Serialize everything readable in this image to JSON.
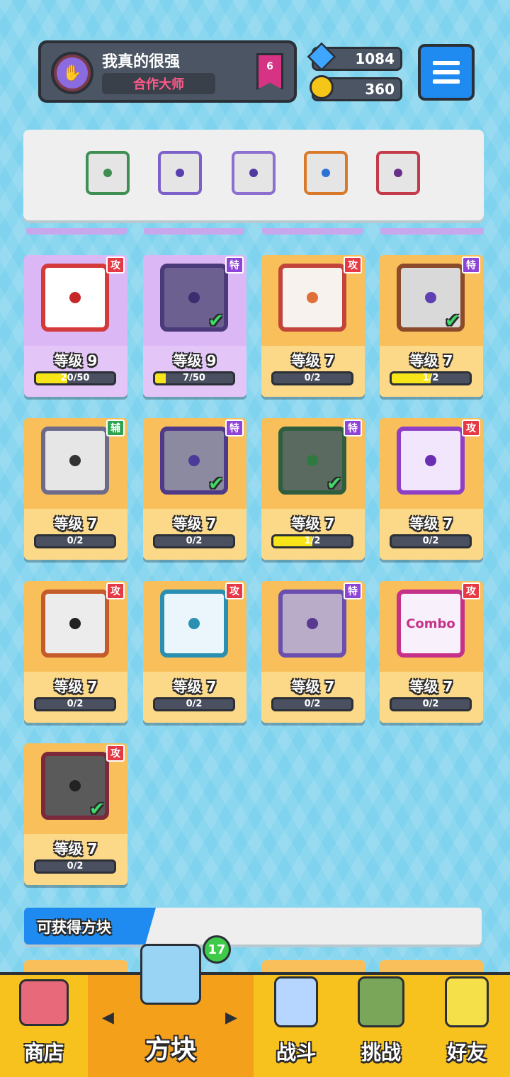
{
  "profile": {
    "name": "我真的很强",
    "title": "合作大师",
    "rank": "6"
  },
  "currency": {
    "gems": "1084",
    "coins": "360"
  },
  "deck": [
    {
      "name": "deck-slot-1",
      "color": "#3f8f55",
      "dot": "#3f8f55"
    },
    {
      "name": "deck-slot-2",
      "color": "#7b61c9",
      "dot": "#5a3fb0"
    },
    {
      "name": "deck-slot-3",
      "color": "#8d6fd1",
      "dot": "#4f3aa0"
    },
    {
      "name": "deck-slot-4",
      "color": "#d97a2b",
      "dot": "#2f72d6"
    },
    {
      "name": "deck-slot-5",
      "color": "#c53a4a",
      "dot": "#6a2f8a"
    }
  ],
  "cards": [
    {
      "type": "攻",
      "type_class": "b-atk",
      "level": "等级 9",
      "progress": "20/50",
      "fill": 0.4,
      "theme": "purple",
      "frame": "#d53a3a",
      "dot": "#c62828",
      "bg": "#ffffff",
      "check": false
    },
    {
      "type": "特",
      "type_class": "b-spe",
      "level": "等级 9",
      "progress": "7/50",
      "fill": 0.14,
      "theme": "purple",
      "frame": "#4a3a7a",
      "dot": "#3b2e70",
      "bg": "#6b6090",
      "check": true
    },
    {
      "type": "攻",
      "type_class": "b-atk",
      "level": "等级 7",
      "progress": "0/2",
      "fill": 0,
      "theme": "gold",
      "frame": "#c2443a",
      "dot": "#e0703a",
      "bg": "#f7f2ee",
      "check": false
    },
    {
      "type": "特",
      "type_class": "b-spe",
      "level": "等级 7",
      "progress": "1/2",
      "fill": 0.5,
      "theme": "gold",
      "frame": "#8b4a2a",
      "dot": "#5f3fb3",
      "bg": "#d9d9d9",
      "check": true
    },
    {
      "type": "辅",
      "type_class": "b-sup",
      "level": "等级 7",
      "progress": "0/2",
      "fill": 0,
      "theme": "gold",
      "frame": "#6e6b8a",
      "dot": "#333333",
      "bg": "#e6e6e6",
      "check": false
    },
    {
      "type": "特",
      "type_class": "b-spe",
      "level": "等级 7",
      "progress": "0/2",
      "fill": 0,
      "theme": "gold",
      "frame": "#4f3a8a",
      "dot": "#4b3a9a",
      "bg": "#8c8aa0",
      "check": true
    },
    {
      "type": "特",
      "type_class": "b-spe",
      "level": "等级 7",
      "progress": "1/2",
      "fill": 0.5,
      "theme": "gold",
      "frame": "#2f5e3f",
      "dot": "#2f7a3f",
      "bg": "#5a6a60",
      "check": true
    },
    {
      "type": "攻",
      "type_class": "b-atk",
      "level": "等级 7",
      "progress": "0/2",
      "fill": 0,
      "theme": "gold",
      "frame": "#8e3fc6",
      "dot": "#6a2fb0",
      "bg": "#f1e6fb",
      "check": false
    },
    {
      "type": "攻",
      "type_class": "b-atk",
      "level": "等级 7",
      "progress": "0/2",
      "fill": 0,
      "theme": "gold",
      "frame": "#c55a2a",
      "dot": "#222222",
      "bg": "#ececec",
      "check": false
    },
    {
      "type": "攻",
      "type_class": "b-atk",
      "level": "等级 7",
      "progress": "0/2",
      "fill": 0,
      "theme": "gold",
      "frame": "#2a8fb0",
      "dot": "#2a8fb0",
      "bg": "#eaf6fb",
      "check": false
    },
    {
      "type": "特",
      "type_class": "b-spe",
      "level": "等级 7",
      "progress": "0/2",
      "fill": 0,
      "theme": "gold",
      "frame": "#6a4fb0",
      "dot": "#5a3a90",
      "bg": "#b8acc8",
      "check": false
    },
    {
      "type": "攻",
      "type_class": "b-atk",
      "level": "等级 7",
      "progress": "0/2",
      "fill": 0,
      "theme": "gold",
      "frame": "#c6328a",
      "dot": "#7a3fc6",
      "bg": "#f8f0fa",
      "check": false,
      "label": "Combo"
    },
    {
      "type": "攻",
      "type_class": "b-atk",
      "level": "等级 7",
      "progress": "0/2",
      "fill": 0,
      "theme": "gold",
      "frame": "#7a2a3a",
      "dot": "#222222",
      "bg": "#5a5a5a",
      "check": true
    }
  ],
  "available": {
    "label": "可获得方块"
  },
  "nav": {
    "shop": "商店",
    "blocks": "方块",
    "battle": "战斗",
    "challenge": "挑战",
    "friends": "好友",
    "badge": "17",
    "left_arrow": "◀",
    "right_arrow": "▶"
  }
}
